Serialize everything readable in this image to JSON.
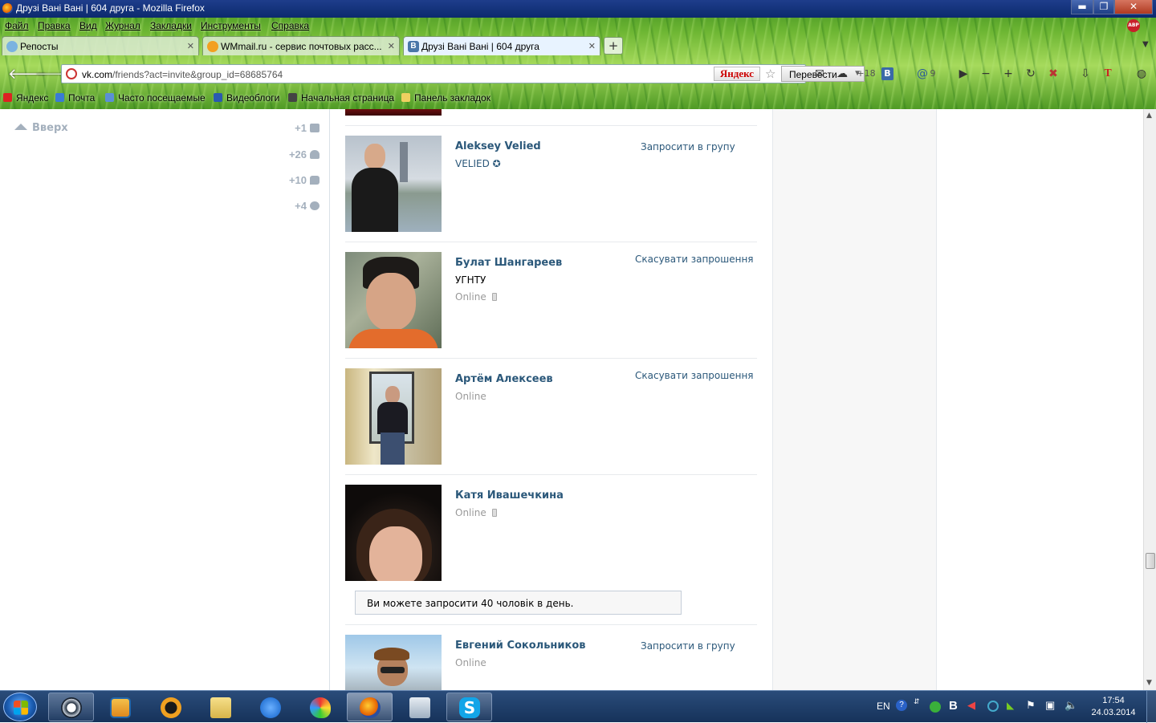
{
  "window": {
    "title": "Друзі Вані Вані | 604 друга - Mozilla Firefox",
    "minimize": "▬",
    "maximize": "❐",
    "close": "✕"
  },
  "menu": [
    "Файл",
    "Правка",
    "Вид",
    "Журнал",
    "Закладки",
    "Инструменты",
    "Справка"
  ],
  "tabs": [
    {
      "label": "Репосты",
      "active": false
    },
    {
      "label": "WMmail.ru - сервис почтовых расс...",
      "active": false
    },
    {
      "label": "Друзі Вані Вані | 604 друга",
      "active": true
    }
  ],
  "tab_close": "✕",
  "new_tab": "+",
  "addressbar": {
    "url_host": "vk.com",
    "url_path": "/friends?act=invite&group_id=68685764",
    "search_logo": "Яндекс",
    "translate_label": "Перевести"
  },
  "toolbar": {
    "weather": "+18",
    "mail_count": "9",
    "font_letter": "T"
  },
  "bookmarks": [
    "Яндекс",
    "Почта",
    "Часто посещаемые",
    "Видеоблоги",
    "Начальная страница",
    "Панель закладок"
  ],
  "sidebar": {
    "up_label": "Вверх",
    "counters": [
      {
        "value": "+1",
        "icon": "mail-icon"
      },
      {
        "value": "+26",
        "icon": "people-icon"
      },
      {
        "value": "+10",
        "icon": "comment-icon"
      },
      {
        "value": "+4",
        "icon": "gear-icon"
      }
    ]
  },
  "friends": [
    {
      "name": "Aleksey Velied",
      "subtitle": "VELIED ✪",
      "status": "",
      "action": "Запросити в групу"
    },
    {
      "name": "Булат Шангареев",
      "subtitle": "УГНТУ",
      "status": "Online",
      "action": "Скасувати запрошення"
    },
    {
      "name": "Артём Алексеев",
      "subtitle": "",
      "status": "Online",
      "action": "Скасувати запрошення"
    },
    {
      "name": "Катя Ивашечкина",
      "subtitle": "",
      "status": "Online",
      "action": ""
    },
    {
      "name": "Евгений Сокольников",
      "subtitle": "",
      "status": "Online",
      "action": "Запросити в групу"
    }
  ],
  "limit_notice": "Ви можете запросити 40 чоловік в день.",
  "taskbar": {
    "lang": "EN",
    "time": "17:54",
    "date": "24.03.2014"
  },
  "colors": {
    "link": "#2b587a",
    "muted": "#a4b0bd",
    "taskbar": "#16325a"
  }
}
